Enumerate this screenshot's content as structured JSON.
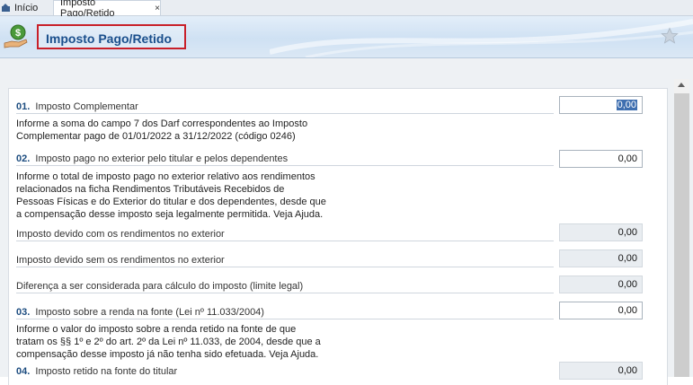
{
  "tabs": [
    {
      "label": "Início",
      "icon": "home-icon"
    },
    {
      "label": "Imposto Pago/Retido",
      "close": "×",
      "active": true
    }
  ],
  "header": {
    "title": "Imposto Pago/Retido",
    "icon": "money-hand-icon",
    "favorite_icon": "star-icon",
    "highlight_color": "#c8202a"
  },
  "form": {
    "q01": {
      "num": "01.",
      "label": "Imposto Complementar",
      "value": "0,00",
      "desc": [
        "Informe a soma do campo 7 dos Darf correspondentes ao Imposto",
        "Complementar pago de 01/01/2022 a 31/12/2022 (código 0246)"
      ]
    },
    "q02": {
      "num": "02.",
      "label": "Imposto pago no exterior pelo titular e pelos dependentes",
      "value": "0,00",
      "desc": [
        "Informe o total de imposto pago no exterior relativo aos rendimentos",
        "relacionados na ficha Rendimentos Tributáveis Recebidos de",
        "Pessoas Físicas e do Exterior do titular e dos dependentes, desde que",
        "a compensação desse imposto seja legalmente permitida. Veja Ajuda."
      ]
    },
    "sub1": {
      "label": "Imposto devido com os rendimentos no exterior",
      "value": "0,00"
    },
    "sub2": {
      "label": "Imposto devido sem os rendimentos no exterior",
      "value": "0,00"
    },
    "sub3": {
      "label": "Diferença a ser considerada para cálculo do imposto (limite legal)",
      "value": "0,00"
    },
    "q03": {
      "num": "03.",
      "label": "Imposto sobre a renda na fonte (Lei nº 11.033/2004)",
      "value": "0,00",
      "desc": [
        "Informe o valor do imposto sobre a renda retido na fonte de que",
        "tratam os §§ 1º e 2º do art. 2º da Lei nº 11.033, de 2004, desde que a",
        "compensação desse imposto já não tenha sido efetuada. Veja Ajuda."
      ]
    },
    "q04": {
      "num": "04.",
      "label": "Imposto retido na fonte do titular",
      "value": "0,00"
    }
  }
}
